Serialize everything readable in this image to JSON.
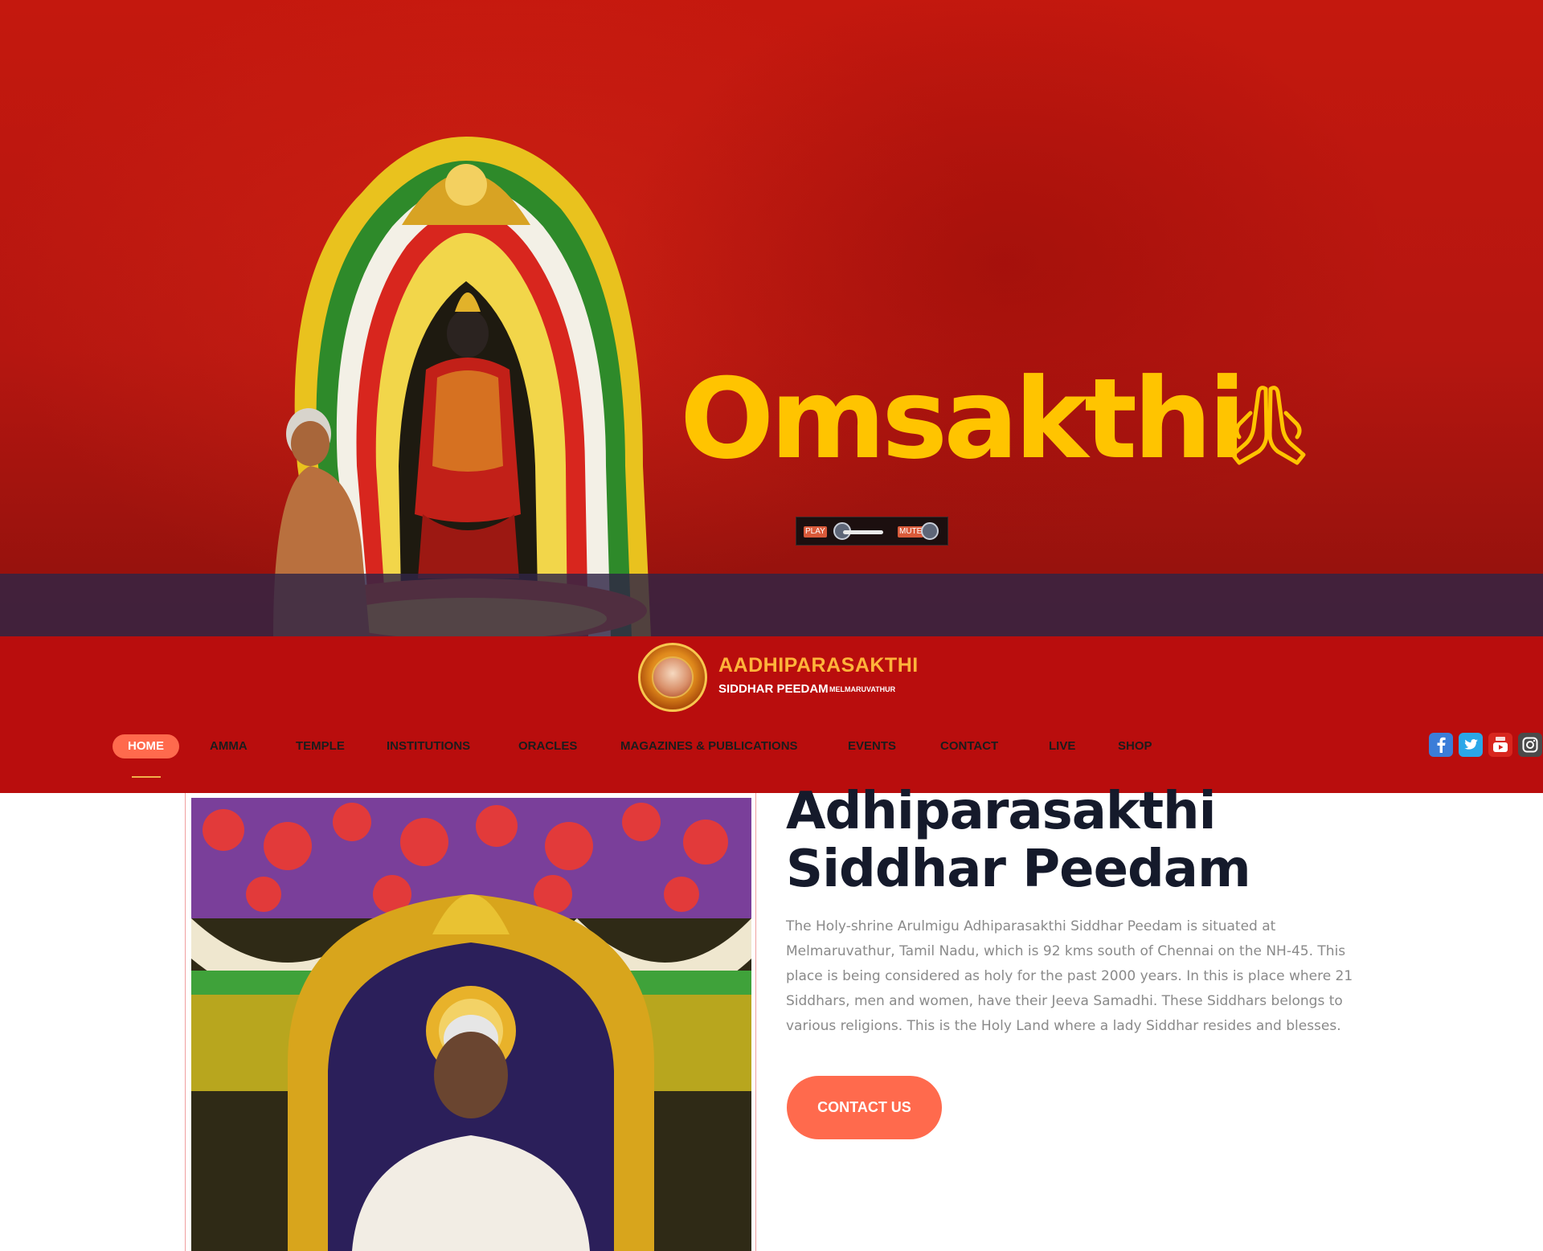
{
  "hero": {
    "title": "Omsakthi",
    "player": {
      "play_label": "PLAY",
      "mute_label": "MUTE"
    }
  },
  "brand": {
    "name": "AADHIPARASAKTHI",
    "subtitle": "SIDDHAR PEEDAM",
    "place": "MELMARUVATHUR"
  },
  "nav": {
    "items": [
      {
        "label": "HOME",
        "active": true
      },
      {
        "label": "AMMA"
      },
      {
        "label": "TEMPLE"
      },
      {
        "label": "INSTITUTIONS"
      },
      {
        "label": "ORACLES"
      },
      {
        "label": "MAGAZINES & PUBLICATIONS"
      },
      {
        "label": "EVENTS"
      },
      {
        "label": "CONTACT"
      },
      {
        "label": "LIVE"
      },
      {
        "label": "SHOP"
      }
    ]
  },
  "social": [
    {
      "name": "facebook-icon",
      "color": "#3b7dd8"
    },
    {
      "name": "twitter-icon",
      "color": "#2aa7e8"
    },
    {
      "name": "youtube-icon",
      "color": "#d8261e"
    },
    {
      "name": "instagram-icon",
      "color": "#4a4a4a"
    }
  ],
  "intro": {
    "heading_line1": "Adhiparasakthi",
    "heading_line2": "Siddhar Peedam",
    "body": "The Holy-shrine Arulmigu Adhiparasakthi Siddhar Peedam is situated at Melmaruvathur, Tamil Nadu, which is 92 kms south of Chennai on the NH-45. This place is being considered as holy for the past 2000 years. In this is place where 21 Siddhars, men and women, have their Jeeva Samadhi. These Siddhars belongs to various religions. This is the Holy Land where a lady Siddhar resides and blesses.",
    "button_label": "CONTACT US"
  },
  "colors": {
    "hero_red": "#b51610",
    "header_red": "#b90d0d",
    "title_yellow": "#ffc400",
    "accent_orange": "#ff6a4d",
    "heading_navy": "#151a2b"
  }
}
